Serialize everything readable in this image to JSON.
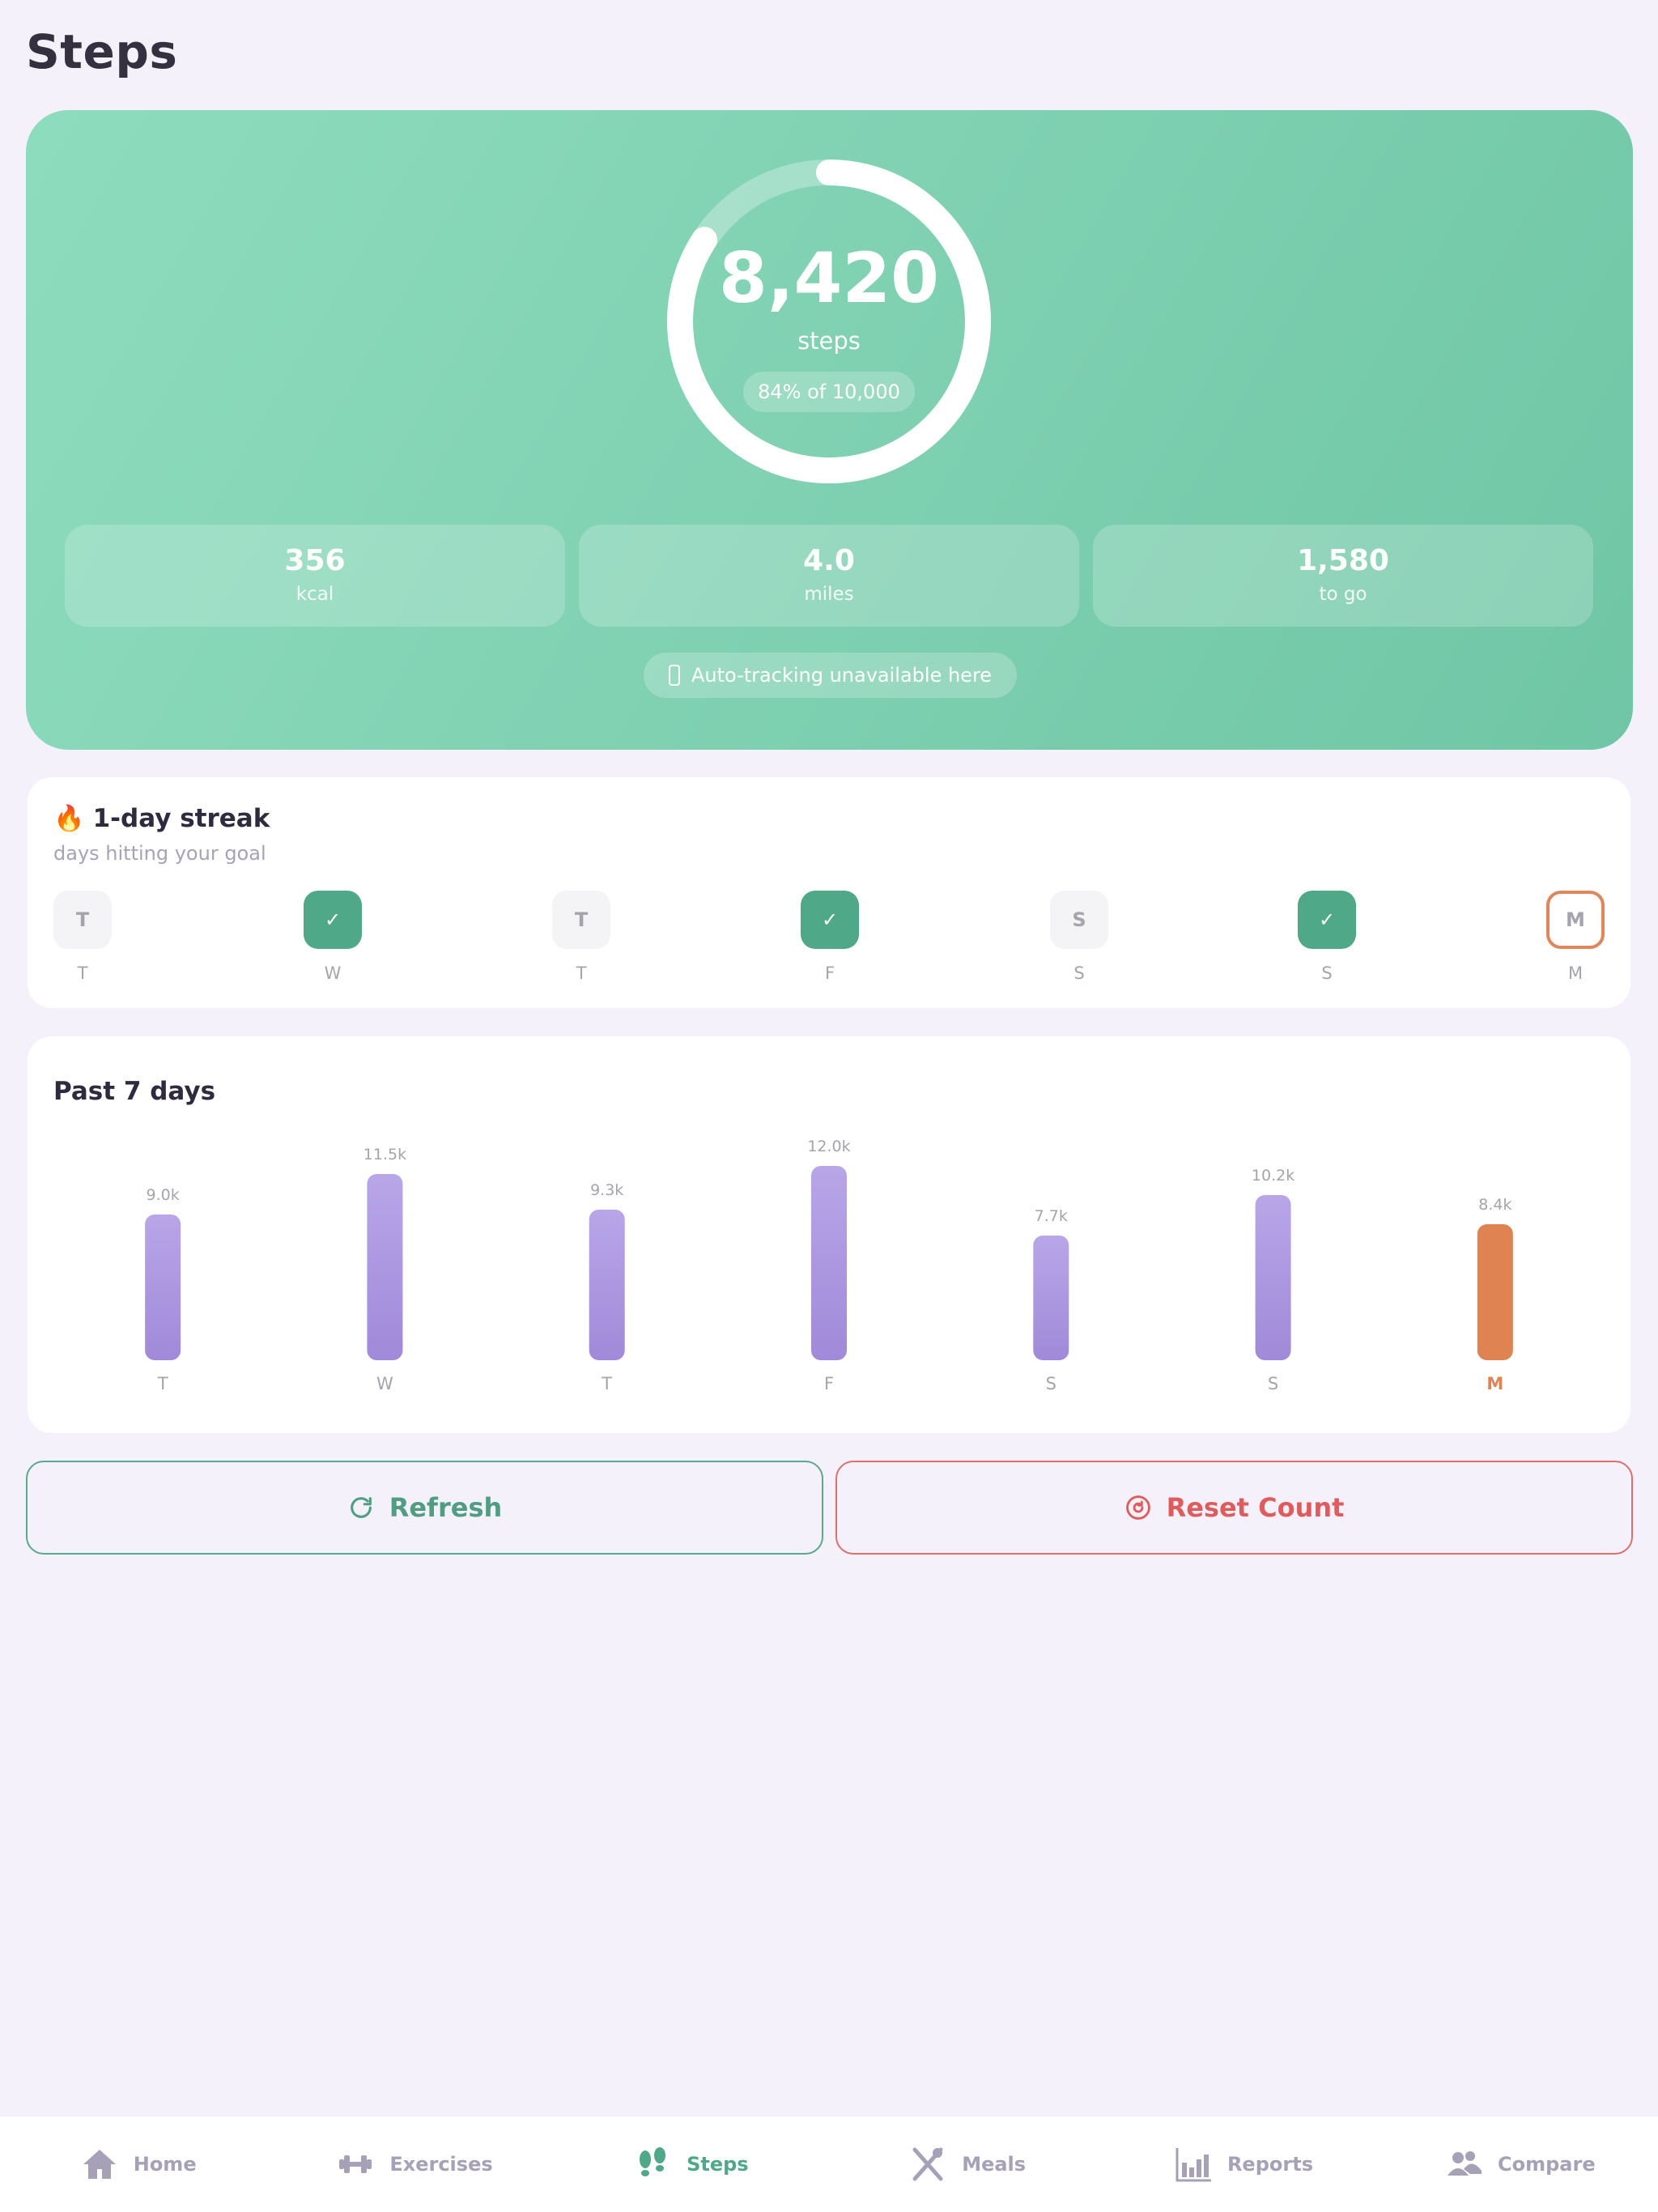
{
  "page": {
    "title": "Steps"
  },
  "hero": {
    "steps": "8,420",
    "unit": "steps",
    "goal_progress": "84% of 10,000",
    "progress_fraction": 0.842,
    "stats": [
      {
        "value": "356",
        "label": "kcal"
      },
      {
        "value": "4.0",
        "label": "miles"
      },
      {
        "value": "1,580",
        "label": "to go"
      }
    ],
    "tracking_notice": "Auto-tracking unavailable here",
    "tracking_icon": "phone-icon"
  },
  "streak": {
    "emoji": "🔥",
    "title": "1-day streak",
    "subtitle": "days hitting your goal",
    "days": [
      {
        "letter": "T",
        "label": "T",
        "state": "missed"
      },
      {
        "letter": "✓",
        "label": "W",
        "state": "done"
      },
      {
        "letter": "T",
        "label": "T",
        "state": "missed"
      },
      {
        "letter": "✓",
        "label": "F",
        "state": "done"
      },
      {
        "letter": "S",
        "label": "S",
        "state": "missed"
      },
      {
        "letter": "✓",
        "label": "S",
        "state": "done"
      },
      {
        "letter": "M",
        "label": "M",
        "state": "today"
      }
    ]
  },
  "chart": {
    "title": "Past 7 days"
  },
  "chart_data": {
    "type": "bar",
    "title": "Past 7 days",
    "categories": [
      "T",
      "W",
      "T",
      "F",
      "S",
      "S",
      "M"
    ],
    "values": [
      9000,
      11500,
      9300,
      12000,
      7700,
      10200,
      8400
    ],
    "value_labels": [
      "9.0k",
      "11.5k",
      "9.3k",
      "12.0k",
      "7.7k",
      "10.2k",
      "8.4k"
    ],
    "highlight_index": 6,
    "colors": {
      "bar": "#a995e0",
      "highlight": "#df8352"
    },
    "ylim": [
      0,
      12000
    ],
    "grid": false
  },
  "actions": {
    "refresh_label": "Refresh",
    "reset_label": "Reset Count"
  },
  "nav": {
    "items": [
      {
        "label": "Home",
        "icon": "home-icon"
      },
      {
        "label": "Exercises",
        "icon": "dumbbell-icon"
      },
      {
        "label": "Steps",
        "icon": "footprints-icon",
        "active": true
      },
      {
        "label": "Meals",
        "icon": "utensils-icon"
      },
      {
        "label": "Reports",
        "icon": "bar-chart-icon"
      },
      {
        "label": "Compare",
        "icon": "users-icon"
      }
    ]
  },
  "colors": {
    "accent": "#4fa887",
    "danger": "#e05c5c",
    "today": "#df8352",
    "background": "#f4f1fb"
  }
}
